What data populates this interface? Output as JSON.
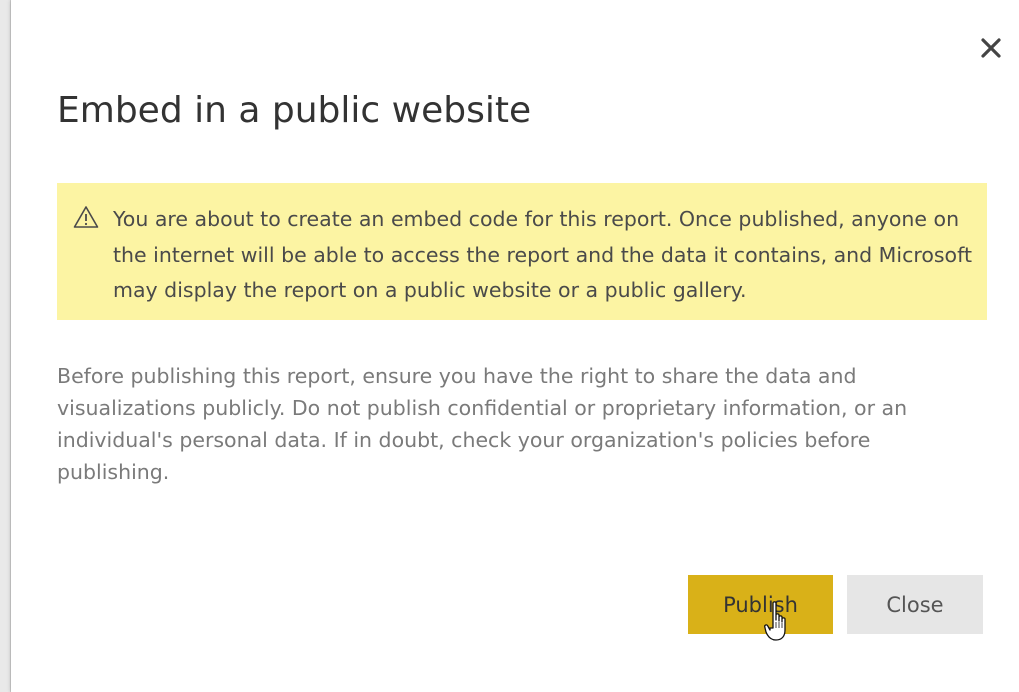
{
  "dialog": {
    "title": "Embed in a public website",
    "close_icon": "close-icon",
    "warning": {
      "icon": "warning-icon",
      "text": "You are about to create an embed code for this report. Once published, anyone on the internet will be able to access the report and the data it contains, and Microsoft may display the report on a public website or a public gallery."
    },
    "info_text": "Before publishing this report, ensure you have the right to share the data and visualizations publicly. Do not publish confidential or proprietary information, or an individual's personal data. If in doubt, check your organization's policies before publishing.",
    "buttons": {
      "publish_label": "Publish",
      "close_label": "Close"
    }
  },
  "colors": {
    "warning_background": "#fcf4a3",
    "publish_button": "#d9b118",
    "close_button": "#e6e6e6"
  }
}
